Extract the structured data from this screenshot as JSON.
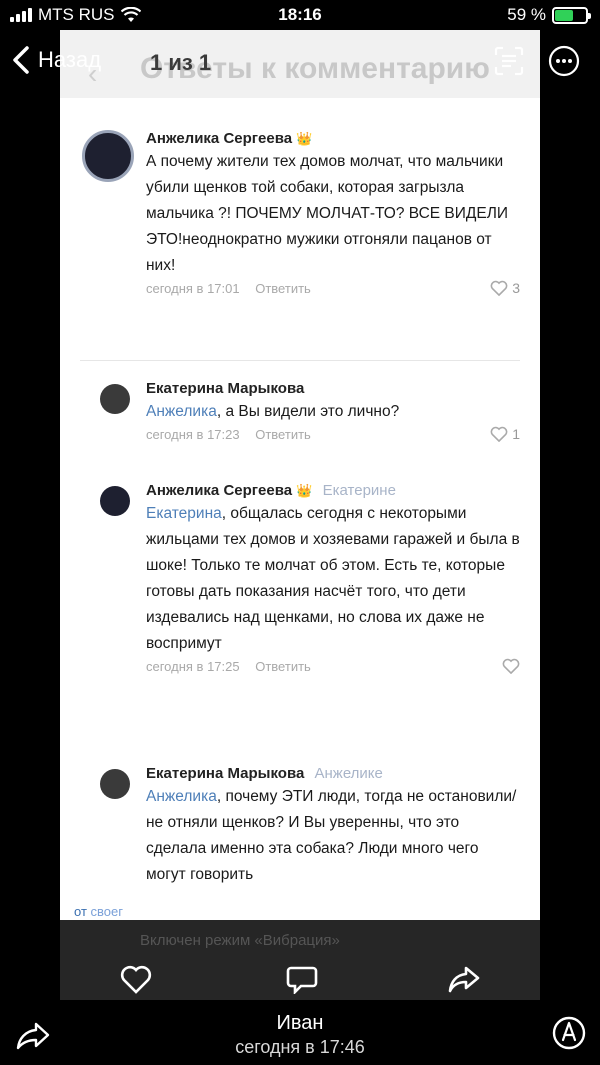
{
  "status_bar": {
    "carrier": "MTS RUS",
    "time": "18:16",
    "battery_percent": "59 %",
    "battery_level": 0.59,
    "battery_color": "#30d158"
  },
  "nav": {
    "back_label": "Назад",
    "counter": "1 из 1",
    "back_icon": "chevron-left-icon",
    "scan_icon": "live-text-icon",
    "more_icon": "more-icon"
  },
  "shot": {
    "header_title": "Ответы к комментарию",
    "comments": [
      {
        "author": "Анжелика Сергеева",
        "crown": "👑",
        "reply_to": "",
        "mention": "",
        "text": "А почему жители тех домов молчат, что мальчики убили щенков той собаки, которая загрызла мальчика ?! ПОЧЕМУ МОЛЧАТ-ТО? ВСЕ ВИДЕЛИ ЭТО!неоднократно мужики отгоняли пацанов от них!",
        "time": "сегодня в 17:01",
        "reply_label": "Ответить",
        "likes": "3"
      },
      {
        "author": "Екатерина Марыкова",
        "crown": "",
        "reply_to": "",
        "mention": "Анжелика",
        "text": ", а Вы видели это лично?",
        "time": "сегодня в 17:23",
        "reply_label": "Ответить",
        "likes": "1"
      },
      {
        "author": "Анжелика Сергеева",
        "crown": "👑",
        "reply_to": "Екатерине",
        "mention": "Екатерина",
        "text": ", общалась сегодня с некоторыми жильцами тех домов и хозяевами гаражей и была в шоке! Только те молчат об этом. Есть те, которые готовы дать показания насчёт того, что дети издевались над щенками, но слова их даже не воспримут",
        "time": "сегодня в 17:25",
        "reply_label": "Ответить",
        "likes": ""
      },
      {
        "author": "Екатерина Марыкова",
        "crown": "",
        "reply_to": "Анжелике",
        "mention": "Анжелика",
        "text": ", почему ЭТИ люди, тогда не остановили/не отняли щенков? И Вы уверенны, что это сделала именно эта собака? Люди много чего могут говорить",
        "time": "",
        "reply_label": "",
        "likes": ""
      }
    ],
    "toast_from": "от",
    "toast_source": "своег",
    "toast_text": "Включен режим «Вибрация»"
  },
  "player_bar": {
    "icons": [
      "heart-icon",
      "comment-icon",
      "repost-icon"
    ]
  },
  "footer": {
    "sender": "Иван",
    "timestamp": "сегодня в 17:46",
    "share_icon": "share-icon",
    "markup_icon": "markup-icon"
  }
}
